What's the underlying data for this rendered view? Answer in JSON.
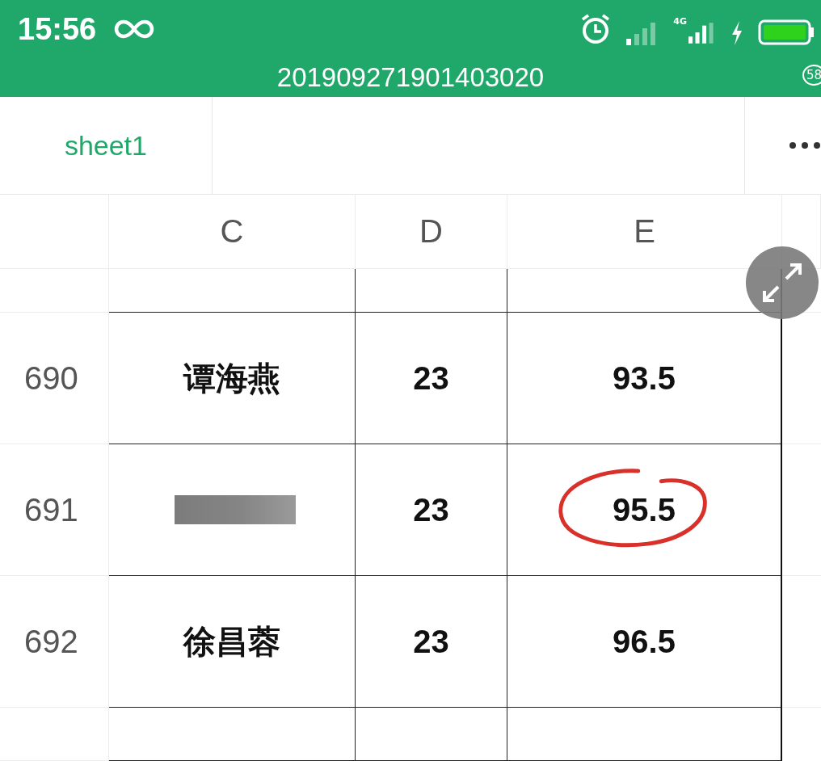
{
  "status_bar": {
    "time": "15:56",
    "network_label": "4G"
  },
  "title_bar": {
    "title": "201909271901403020",
    "badge": "58"
  },
  "tabs": [
    {
      "label": "sheet1",
      "selected": true
    }
  ],
  "columns": [
    "C",
    "D",
    "E"
  ],
  "rows": [
    {
      "kind": "blank"
    },
    {
      "kind": "data",
      "number": "690",
      "cells": [
        {
          "kind": "text",
          "text": "谭海燕"
        },
        {
          "kind": "text",
          "text": "23"
        },
        {
          "kind": "text",
          "text": "93.5",
          "annotated": false
        }
      ]
    },
    {
      "kind": "data",
      "number": "691",
      "cells": [
        {
          "kind": "redacted"
        },
        {
          "kind": "text",
          "text": "23"
        },
        {
          "kind": "text",
          "text": "95.5",
          "annotated": true
        }
      ]
    },
    {
      "kind": "data",
      "number": "692",
      "cells": [
        {
          "kind": "text",
          "text": "徐昌蓉"
        },
        {
          "kind": "text",
          "text": "23"
        },
        {
          "kind": "text",
          "text": "96.5",
          "annotated": false
        }
      ]
    },
    {
      "kind": "blank"
    }
  ]
}
